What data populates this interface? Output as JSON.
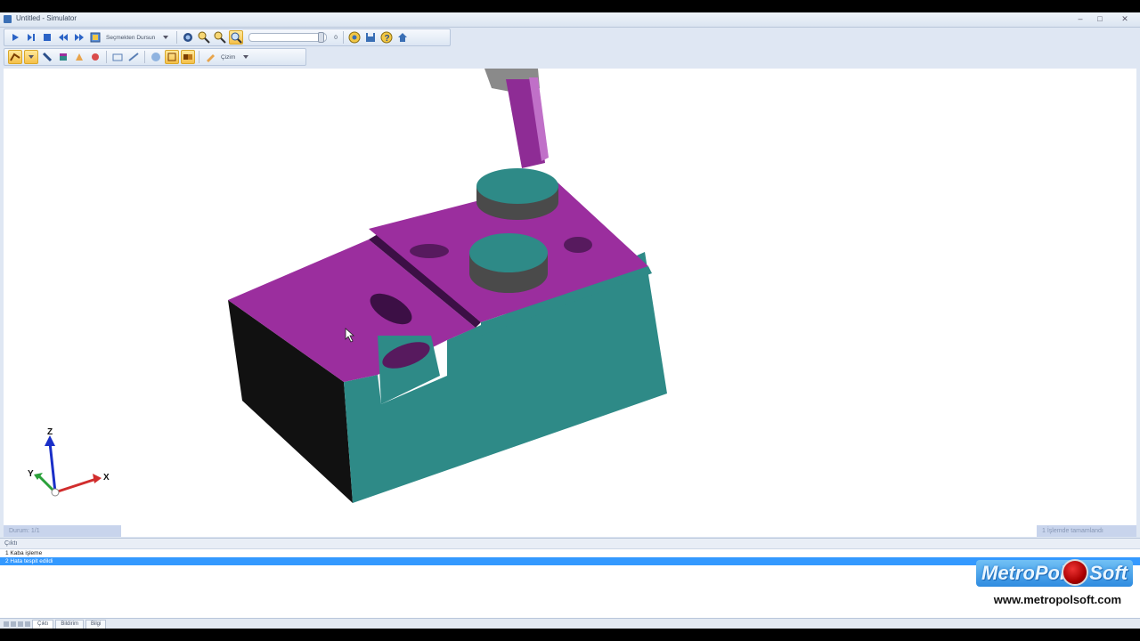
{
  "window": {
    "title": "Untitled - Simulator",
    "controls": {
      "minimize": "–",
      "maximize": "□",
      "close": "✕"
    }
  },
  "toolbar1": {
    "process_combo": "Seçmekten Dursun",
    "slider_value": "0"
  },
  "toolbar2": {
    "view_combo": "Çizim"
  },
  "viewport": {
    "left_status": "Durum: 1/1",
    "right_status": "1 İşlemde tamamlandı",
    "axes": {
      "x": "X",
      "y": "Y",
      "z": "Z"
    },
    "colors": {
      "top": "#9b2e9e",
      "side": "#2e8a87",
      "shadow": "#111111",
      "tool": "#8e2c95"
    }
  },
  "operations_panel": {
    "header": "Çıktı",
    "rows": [
      {
        "label": "1 Kaba işleme",
        "selected": false
      },
      {
        "label": "2 Hata tespit edildi",
        "selected": true
      }
    ],
    "tabs": [
      "Çıktı",
      "Bildirim",
      "Bilgi"
    ]
  },
  "branding": {
    "logo_left": "MetroPol",
    "logo_right": "Soft",
    "website": "www.metropolsoft.com"
  }
}
